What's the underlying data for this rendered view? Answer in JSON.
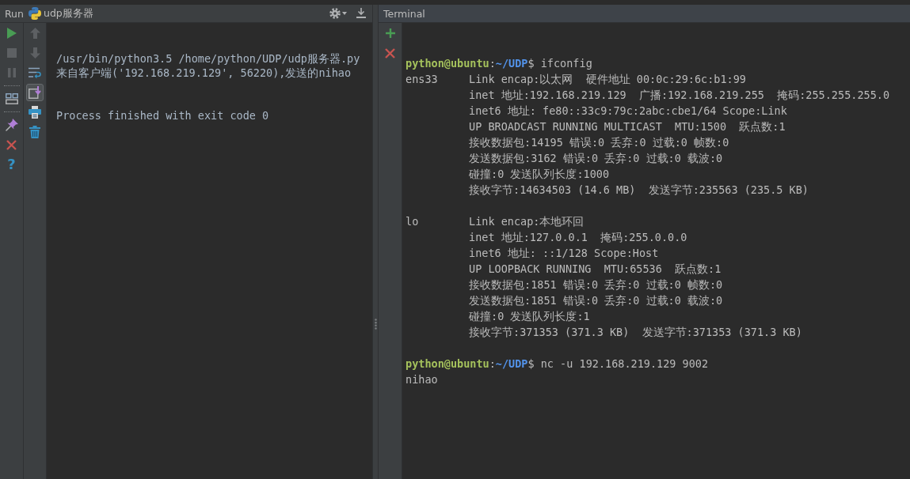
{
  "run_panel": {
    "label": "Run",
    "config_name": "udp服务器",
    "header_buttons": [
      {
        "kind": "settings"
      },
      {
        "kind": "hide"
      }
    ],
    "main_toolbar": [
      {
        "items": [
          {
            "kind": "run",
            "disabled": false
          },
          {
            "kind": "stop",
            "disabled": true
          },
          {
            "kind": "pause",
            "disabled": true
          }
        ]
      },
      {
        "items": [
          {
            "kind": "layout",
            "disabled": false
          }
        ]
      },
      {
        "items": [
          {
            "kind": "pin",
            "disabled": false
          },
          {
            "kind": "close",
            "disabled": false
          },
          {
            "kind": "help",
            "glyph": "?",
            "disabled": false
          }
        ]
      }
    ],
    "side_toolbar": [
      {
        "kind": "up",
        "disabled": true,
        "on": false
      },
      {
        "kind": "down",
        "disabled": true,
        "on": false
      },
      {
        "kind": "wrap",
        "disabled": false,
        "on": false
      },
      {
        "kind": "scroll_end",
        "disabled": false,
        "on": true
      },
      {
        "kind": "print",
        "disabled": false,
        "on": false
      },
      {
        "kind": "clear",
        "disabled": false,
        "on": false
      }
    ],
    "console": [
      {
        "kind": "command",
        "text": "/usr/bin/python3.5 /home/python/UDP/udp服务器.py"
      },
      {
        "kind": "output",
        "text": "来自客户端('192.168.219.129', 56220),发送的nihao"
      },
      {
        "kind": "exit",
        "text": "Process finished with exit code 0"
      }
    ]
  },
  "terminal": {
    "title": "Terminal",
    "toolbar": [
      {
        "kind": "new_session"
      },
      {
        "kind": "close_session"
      }
    ],
    "entries": [
      {
        "kind": "prompt",
        "user": "python@ubuntu",
        "separator": ":",
        "path": "~/UDP",
        "symbol": "$",
        "command": "ifconfig"
      },
      {
        "kind": "interface",
        "name": "ens33",
        "lines": [
          "Link encap:以太网  硬件地址 00:0c:29:6c:b1:99",
          "inet 地址:192.168.219.129  广播:192.168.219.255  掩码:255.255.255.0",
          "inet6 地址: fe80::33c9:79c:2abc:cbe1/64 Scope:Link",
          "UP BROADCAST RUNNING MULTICAST  MTU:1500  跃点数:1",
          "接收数据包:14195 错误:0 丢弃:0 过载:0 帧数:0",
          "发送数据包:3162 错误:0 丢弃:0 过载:0 载波:0",
          "碰撞:0 发送队列长度:1000",
          "接收字节:14634503 (14.6 MB)  发送字节:235563 (235.5 KB)"
        ]
      },
      {
        "kind": "interface",
        "name": "lo",
        "lines": [
          "Link encap:本地环回",
          "inet 地址:127.0.0.1  掩码:255.0.0.0",
          "inet6 地址: ::1/128 Scope:Host",
          "UP LOOPBACK RUNNING  MTU:65536  跃点数:1",
          "接收数据包:1851 错误:0 丢弃:0 过载:0 帧数:0",
          "发送数据包:1851 错误:0 丢弃:0 过载:0 载波:0",
          "碰撞:0 发送队列长度:1",
          "接收字节:371353 (371.3 KB)  发送字节:371353 (371.3 KB)"
        ]
      },
      {
        "kind": "prompt",
        "user": "python@ubuntu",
        "separator": ":",
        "path": "~/UDP",
        "symbol": "$",
        "command": "nc -u 192.168.219.129 9002"
      },
      {
        "kind": "output",
        "text": "nihao"
      }
    ]
  }
}
